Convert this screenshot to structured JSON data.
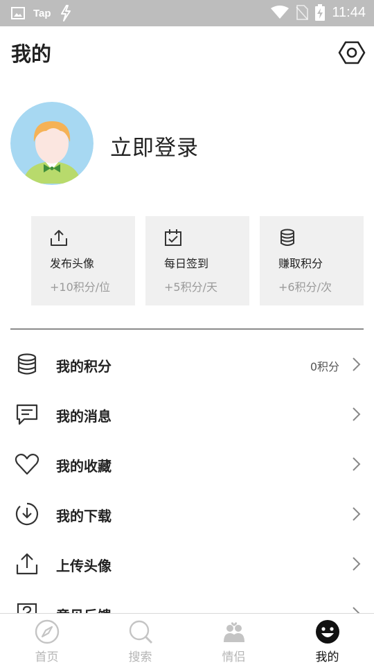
{
  "status_bar": {
    "app_label": "Tap",
    "time": "11:44"
  },
  "header": {
    "title": "我的",
    "settings_icon": "settings-hexagon-icon"
  },
  "profile": {
    "login_text": "立即登录"
  },
  "cards": [
    {
      "icon": "upload-icon",
      "title": "发布头像",
      "subtitle": "+10积分/位"
    },
    {
      "icon": "calendar-check-icon",
      "title": "每日签到",
      "subtitle": "+5积分/天"
    },
    {
      "icon": "coins-stack-icon",
      "title": "赚取积分",
      "subtitle": "+6积分/次"
    }
  ],
  "menu": [
    {
      "icon": "coins-stack-icon",
      "label": "我的积分",
      "value": "0积分"
    },
    {
      "icon": "message-icon",
      "label": "我的消息",
      "value": ""
    },
    {
      "icon": "heart-icon",
      "label": "我的收藏",
      "value": ""
    },
    {
      "icon": "download-icon",
      "label": "我的下载",
      "value": ""
    },
    {
      "icon": "upload-icon",
      "label": "上传头像",
      "value": ""
    },
    {
      "icon": "feedback-icon",
      "label": "意见反馈",
      "value": ""
    }
  ],
  "bottom_nav": {
    "active": "我的",
    "items": [
      {
        "icon": "compass-icon",
        "label": "首页"
      },
      {
        "icon": "search-icon",
        "label": "搜索"
      },
      {
        "icon": "couple-icon",
        "label": "情侣"
      },
      {
        "icon": "smiley-icon",
        "label": "我的"
      }
    ]
  },
  "colors": {
    "status_bar": "#bdbdbd",
    "card_bg": "#f0f0f0",
    "text_primary": "#222222",
    "text_secondary": "#9a9a9a",
    "nav_inactive": "#b5b5b5"
  }
}
